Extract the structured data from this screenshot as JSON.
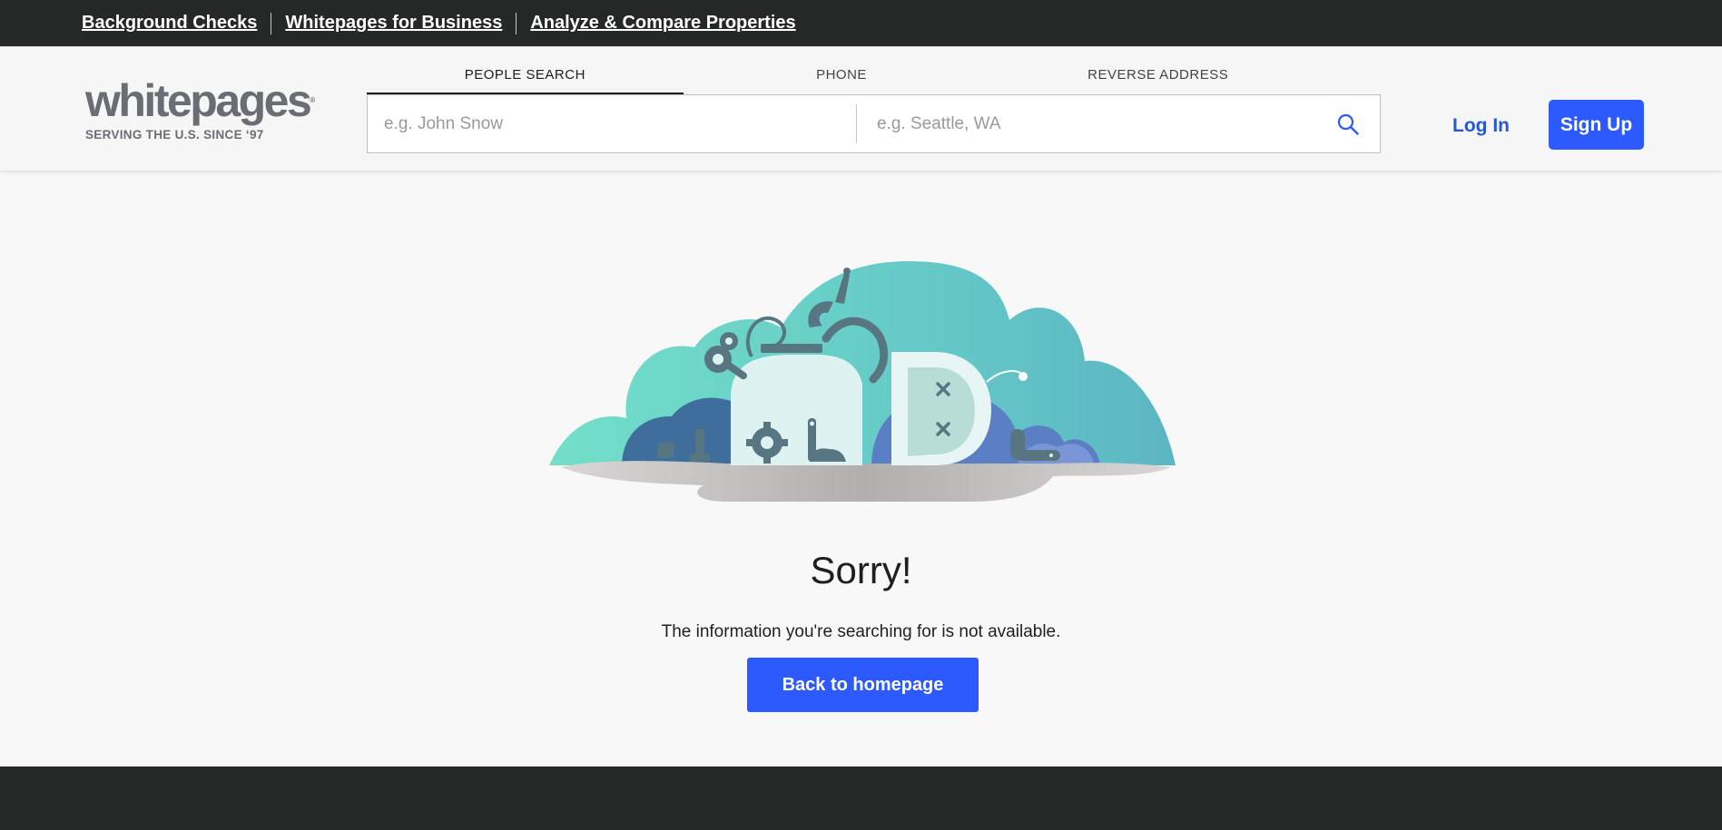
{
  "topbar": {
    "links": [
      "Background Checks",
      "Whitepages for Business",
      "Analyze & Compare Properties"
    ]
  },
  "logo": {
    "word": "whitepages",
    "tagline": "SERVING THE U.S. SINCE ‘97"
  },
  "search": {
    "tabs": [
      "PEOPLE SEARCH",
      "PHONE",
      "REVERSE ADDRESS"
    ],
    "active_tab": "PEOPLE SEARCH",
    "name_placeholder": "e.g. John Snow",
    "location_placeholder": "e.g. Seattle, WA",
    "name_value": "",
    "location_value": ""
  },
  "auth": {
    "login_label": "Log In",
    "signup_label": "Sign Up"
  },
  "error": {
    "title": "Sorry!",
    "message": "The information you're searching for is not available.",
    "button_label": "Back to homepage"
  },
  "colors": {
    "brand_blue": "#2c5aff",
    "link_blue": "#2558d6",
    "dark_bar": "#262828"
  }
}
